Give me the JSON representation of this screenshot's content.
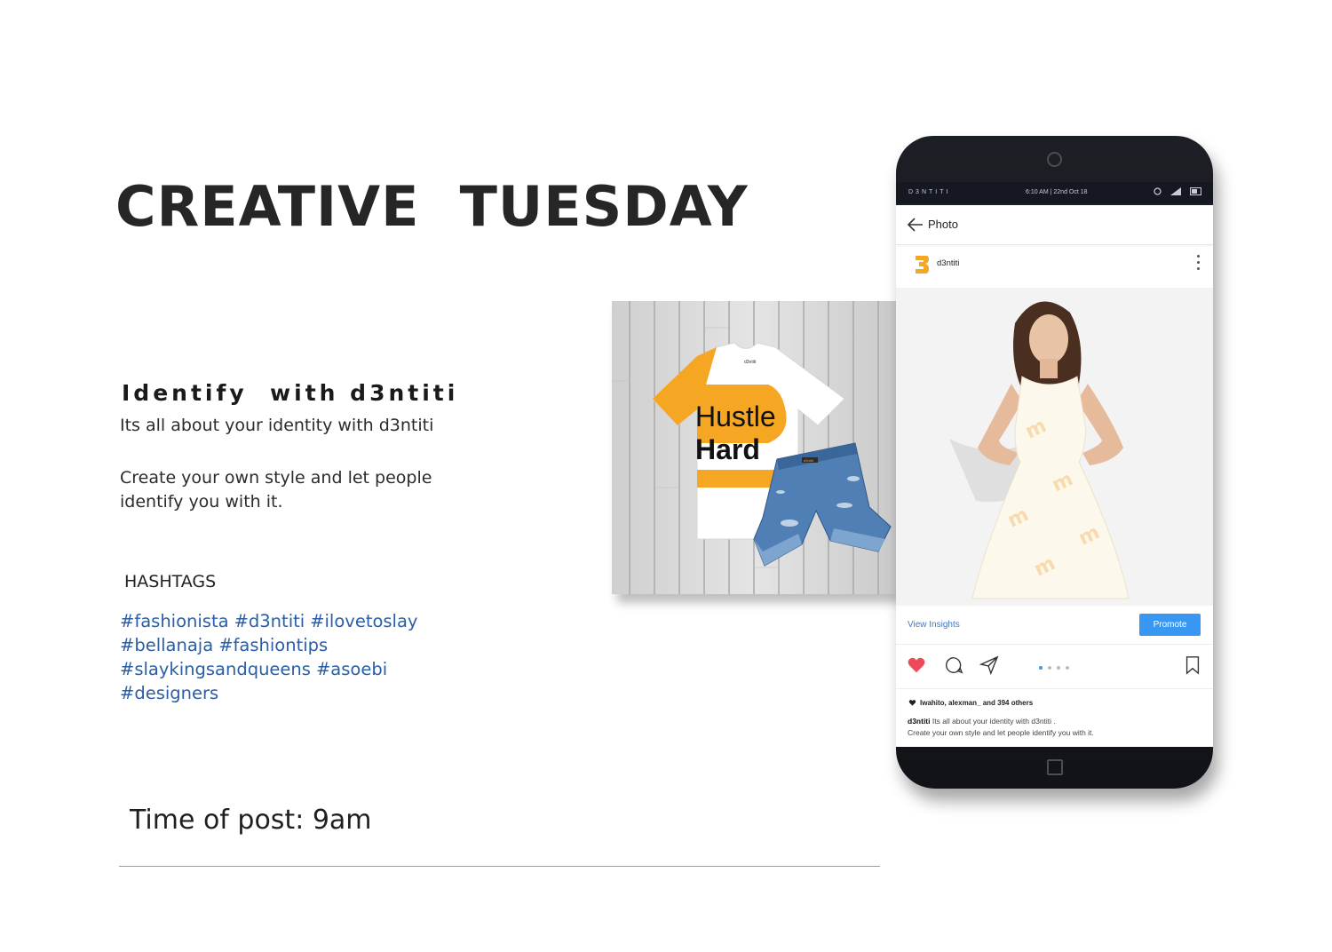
{
  "headline": "CREATIVE  TUESDAY",
  "subtitle": "Identify  with d3ntiti",
  "body": {
    "line1": "Its all about your identity with d3ntiti",
    "line2": "Create your own style and let people identify you with it."
  },
  "hashtags_heading": "HASHTAGS",
  "hashtags": [
    "#fashionista",
    "#d3ntiti",
    "#ilovetoslay",
    "#bellanaja",
    "#fashiontips",
    "#slaykingsandqueens",
    "#asoebi",
    "#designers"
  ],
  "post_time": "Time of post: 9am",
  "product_photo": {
    "shirt_text_line1": "Hustle",
    "shirt_text_line2": "Hard",
    "shirt_tag": "d3ntiti",
    "shorts_tag": "d3ntiti"
  },
  "phone": {
    "status_brand": "D3NTITI",
    "status_time": "6:10 AM | 22nd Oct 18",
    "app_bar_title": "Photo",
    "post_user": "d3ntiti",
    "view_insights": "View Insights",
    "promote": "Promote",
    "likes": "lwahito, alexman_ and 394 others",
    "caption_user": "d3ntiti",
    "caption_text": "Its all about your identity with d3ntiti .",
    "caption_text2": "Create your own style and let people identify you with it."
  },
  "colors": {
    "brand_orange": "#f5a623",
    "hashtag_blue": "#2a5fa8",
    "link_blue": "#3f79c9",
    "button_blue": "#3897f0",
    "like_red": "#ed4956",
    "phone_body": "#15181e"
  }
}
